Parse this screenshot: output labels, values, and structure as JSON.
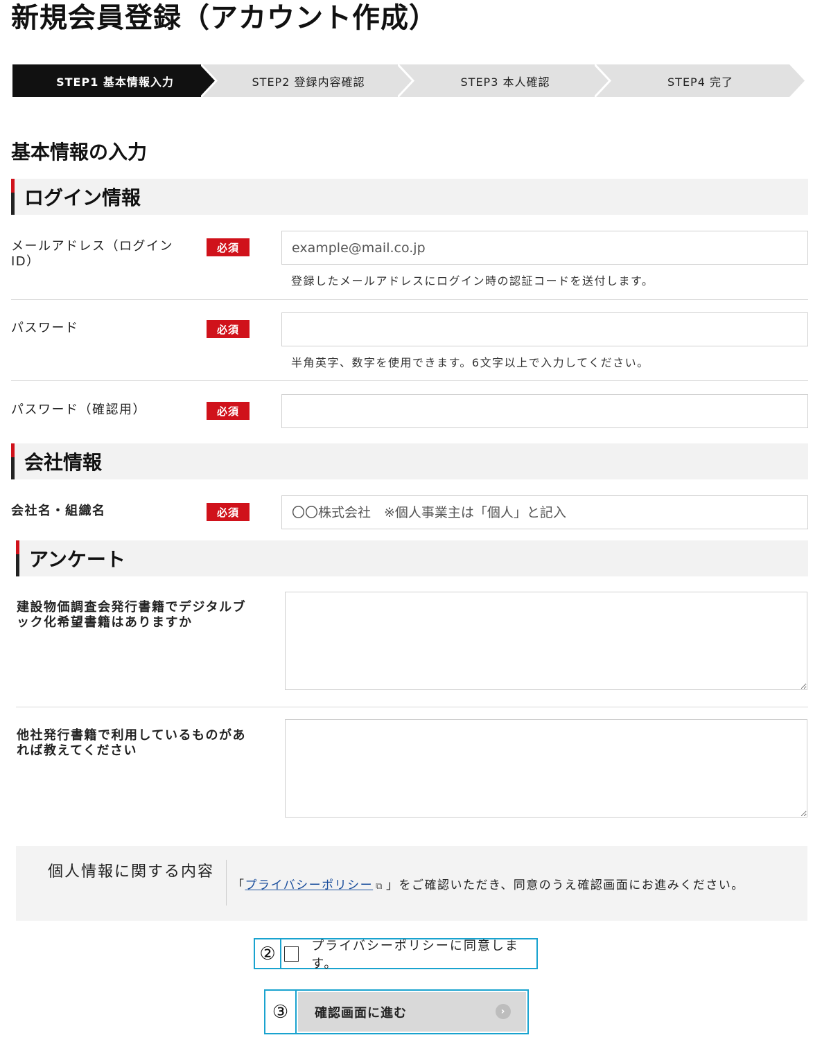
{
  "page": {
    "title": "新規会員登録（アカウント作成）"
  },
  "steps": [
    {
      "label": "STEP1 基本情報入力",
      "active": true
    },
    {
      "label": "STEP2 登録内容確認",
      "active": false
    },
    {
      "label": "STEP3 本人確認",
      "active": false
    },
    {
      "label": "STEP4 完了",
      "active": false
    }
  ],
  "section_heading": "基本情報の入力",
  "login": {
    "title": "ログイン情報",
    "email_label": "メールアドレス（ログインID）",
    "email_placeholder": "example@mail.co.jp",
    "email_hint": "登録したメールアドレスにログイン時の認証コードを送付します。",
    "password_label": "パスワード",
    "password_hint": "半角英字、数字を使用できます。6文字以上で入力してください。",
    "password_confirm_label": "パスワード（確認用）"
  },
  "required_badge": "必須",
  "company": {
    "title": "会社情報",
    "name_label": "会社名・組織名",
    "name_placeholder": "〇〇株式会社　※個人事業主は「個人」と記入"
  },
  "survey": {
    "title": "アンケート",
    "q1_label": "建設物価調査会発行書籍でデジタルブック化希望書籍はありますか",
    "q2_label": "他社発行書籍で利用しているものがあれば教えてください"
  },
  "privacy": {
    "title": "個人情報に関する内容",
    "text_before": "「",
    "link": "プライバシーポリシー",
    "text_after": "」をご確認いただき、同意のうえ確認画面にお進みください。",
    "agree_label": "プライバシーポリシーに同意します。",
    "agree_checked": false
  },
  "markers": {
    "checkbox": "②",
    "button": "③"
  },
  "submit": {
    "label": "確認画面に進む",
    "arrow_icon": "chevron-right-icon"
  },
  "colors": {
    "accent_red": "#d0121b",
    "step_active": "#111111",
    "step_inactive": "#e1e1e1",
    "highlight": "#19a3cf"
  }
}
